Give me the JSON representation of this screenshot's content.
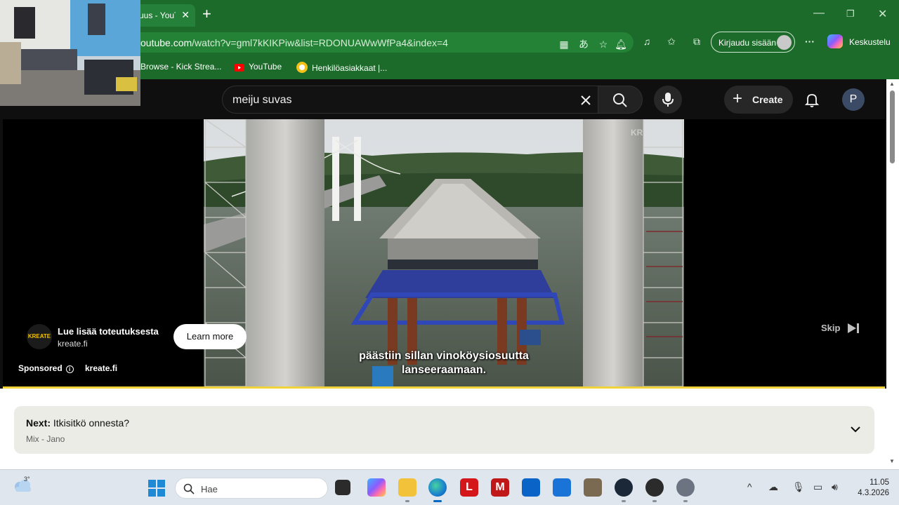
{
  "browser": {
    "tab_title": "uus - YouTube",
    "url_host": "outube.com",
    "url_path": "/watch?v=gml7kKIKPiw&list=RDONUAWwWfPa4&index=4",
    "signin_label": "Kirjaudu sisään",
    "copilot_label": "Keskustelu",
    "bookmarks": [
      {
        "label": "Browse - Kick Strea...",
        "icon": "kick-icon"
      },
      {
        "label": "YouTube",
        "icon": "youtube-icon"
      },
      {
        "label": "Henkilöasiakkaat |...",
        "icon": "bank-icon"
      }
    ]
  },
  "youtube": {
    "search_query": "meiju suvas",
    "create_label": "Create",
    "avatar_letter": "P"
  },
  "player": {
    "caption_line1": "päästiin sillan vinoköysiosuutta",
    "caption_line2": "lanseeraamaan.",
    "watermark": "KR",
    "ad_logo_text": "KREATE",
    "ad_title": "Lue lisää toteutuksesta",
    "ad_domain": "kreate.fi",
    "learn_more": "Learn more",
    "sponsored": "Sponsored",
    "sponsored_domain": "kreate.fi",
    "skip": "Skip",
    "ad_progress_color": "#f2d43a"
  },
  "next": {
    "prefix": "Next:",
    "title": "Itkisitkö onnesta?",
    "subtitle": "Mix - Jano"
  },
  "taskbar": {
    "weather_temp": "3°",
    "search_placeholder": "Hae",
    "time": "11.05",
    "date": "4.3.2026",
    "pinned_apps": [
      "task-view-icon",
      "copilot-icon",
      "file-explorer-icon",
      "edge-icon",
      "l-app-icon",
      "mcafee-icon",
      "outlook-icon",
      "store-icon",
      "game-icon",
      "steam-icon",
      "obs-icon",
      "settings-icon"
    ]
  }
}
